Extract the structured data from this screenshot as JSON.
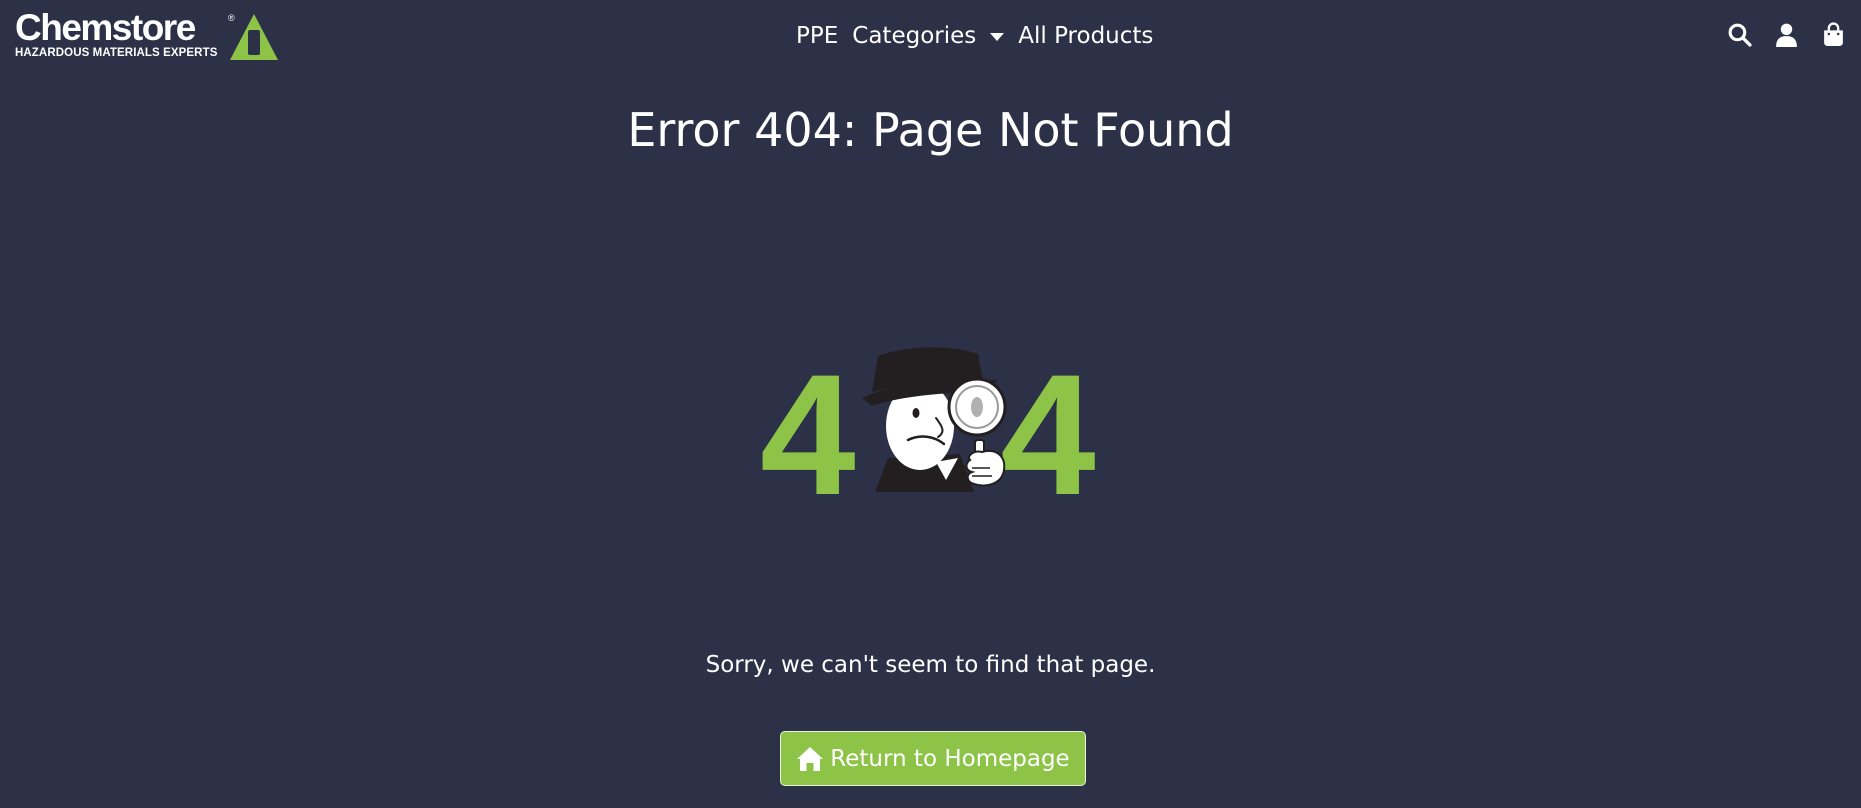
{
  "brand": {
    "name": "Chemstore",
    "registered_mark": "®",
    "tagline": "HAZARDOUS MATERIALS EXPERTS",
    "accent_color": "#8dc447"
  },
  "nav": {
    "items": [
      {
        "label": "PPE"
      },
      {
        "label": "Categories",
        "has_dropdown": true
      },
      {
        "label": "All Products"
      }
    ]
  },
  "header_icons": [
    "search-icon",
    "user-icon",
    "shopping-bag-icon"
  ],
  "main": {
    "title": "Error 404: Page Not Found",
    "illustration": {
      "left_digit": "4",
      "right_digit": "4",
      "subject": "detective-with-magnifying-glass"
    },
    "message": "Sorry, we can't seem to find that page.",
    "button": {
      "label": "Return to Homepage",
      "icon": "home-icon"
    }
  },
  "colors": {
    "background": "#2d3147",
    "accent": "#8dc447",
    "text": "#ffffff"
  }
}
